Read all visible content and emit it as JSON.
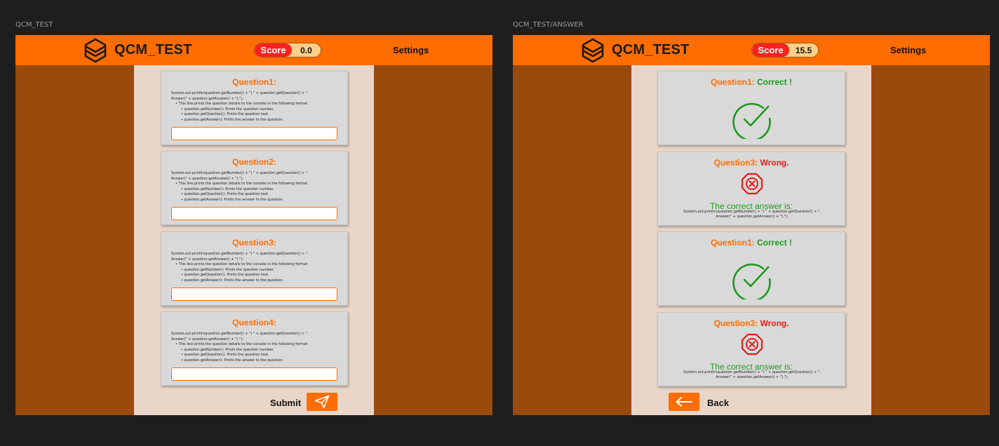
{
  "frames": {
    "test_label": "QCM_TEST",
    "answer_label": "QCM_TEST/ANSWER"
  },
  "colors": {
    "primary": "#ff6c00",
    "background_band": "#9a4a0c",
    "content_panel": "#e9d6c8",
    "card": "#d9d9d9",
    "correct": "#1e9a1e",
    "wrong": "#e51c1c",
    "score_badge": "#ff2020"
  },
  "test_screen": {
    "header": {
      "app_title": "QCM_TEST",
      "score_label": "Score",
      "score_value": "0.0",
      "settings_label": "Settings",
      "logo_icon": "cube-logo-icon"
    },
    "questions": [
      {
        "title": "Question1:",
        "code_line1": "System.out.println(question.getNumber() + \") \" + question.getQuestion() + \".",
        "code_line2": "Answer(\" + question.getAnswer() + \").\");",
        "explanation": "This line prints the question details to the console in the following format:",
        "items": [
          "question.getNumber(): Prints the question number.",
          "question.getQuestion(): Prints the question text.",
          "question.getAnswer(): Prints the answer to the question."
        ],
        "input_value": ""
      },
      {
        "title": "Question2:",
        "code_line1": "System.out.println(question.getNumber() + \") \" + question.getQuestion() + \".",
        "code_line2": "Answer(\" + question.getAnswer() + \").\");",
        "explanation": "This line prints the question details to the console in the following format:",
        "items": [
          "question.getNumber(): Prints the question number.",
          "question.getQuestion(): Prints the question text.",
          "question.getAnswer(): Prints the answer to the question."
        ],
        "input_value": ""
      },
      {
        "title": "Question3:",
        "code_line1": "System.out.println(question.getNumber() + \") \" + question.getQuestion() + \".",
        "code_line2": "Answer(\" + question.getAnswer() + \").\");",
        "explanation": "This line prints the question details to the console in the following format:",
        "items": [
          "question.getNumber(): Prints the question number.",
          "question.getQuestion(): Prints the question text.",
          "question.getAnswer(): Prints the answer to the question."
        ],
        "input_value": ""
      },
      {
        "title": "Question4:",
        "code_line1": "System.out.println(question.getNumber() + \") \" + question.getQuestion() + \".",
        "code_line2": "Answer(\" + question.getAnswer() + \").\");",
        "explanation": "This line prints the question details to the console in the following format:",
        "items": [
          "question.getNumber(): Prints the question number.",
          "question.getQuestion(): Prints the question text.",
          "question.getAnswer(): Prints the answer to the question."
        ],
        "input_value": ""
      }
    ],
    "submit_label": "Submit",
    "submit_icon": "send-icon"
  },
  "answer_screen": {
    "header": {
      "app_title": "QCM_TEST",
      "score_label": "Score",
      "score_value": "15.5",
      "settings_label": "Settings",
      "logo_icon": "cube-logo-icon"
    },
    "results": [
      {
        "question": "Question1:",
        "verdict": "Correct !",
        "status": "correct",
        "icon": "check-circle-icon"
      },
      {
        "question": "Question3:",
        "verdict": "Wrong.",
        "status": "wrong",
        "icon": "x-octagon-icon",
        "correct_heading": "The correct answer is:",
        "correct_line1": "System.out.println(question.getNumber() + \") \" + question.getQuestion() + \".",
        "correct_line2": "Answer(\" + question.getAnswer() + \").\");"
      },
      {
        "question": "Question1:",
        "verdict": "Correct !",
        "status": "correct",
        "icon": "check-circle-icon"
      },
      {
        "question": "Question3:",
        "verdict": "Wrong.",
        "status": "wrong",
        "icon": "x-octagon-icon",
        "correct_heading": "The correct answer is:",
        "correct_line1": "System.out.println(question.getNumber() + \") \" + question.getQuestion() + \".",
        "correct_line2": "Answer(\" + question.getAnswer() + \").\");"
      }
    ],
    "back_label": "Back",
    "back_icon": "arrow-left-icon"
  }
}
